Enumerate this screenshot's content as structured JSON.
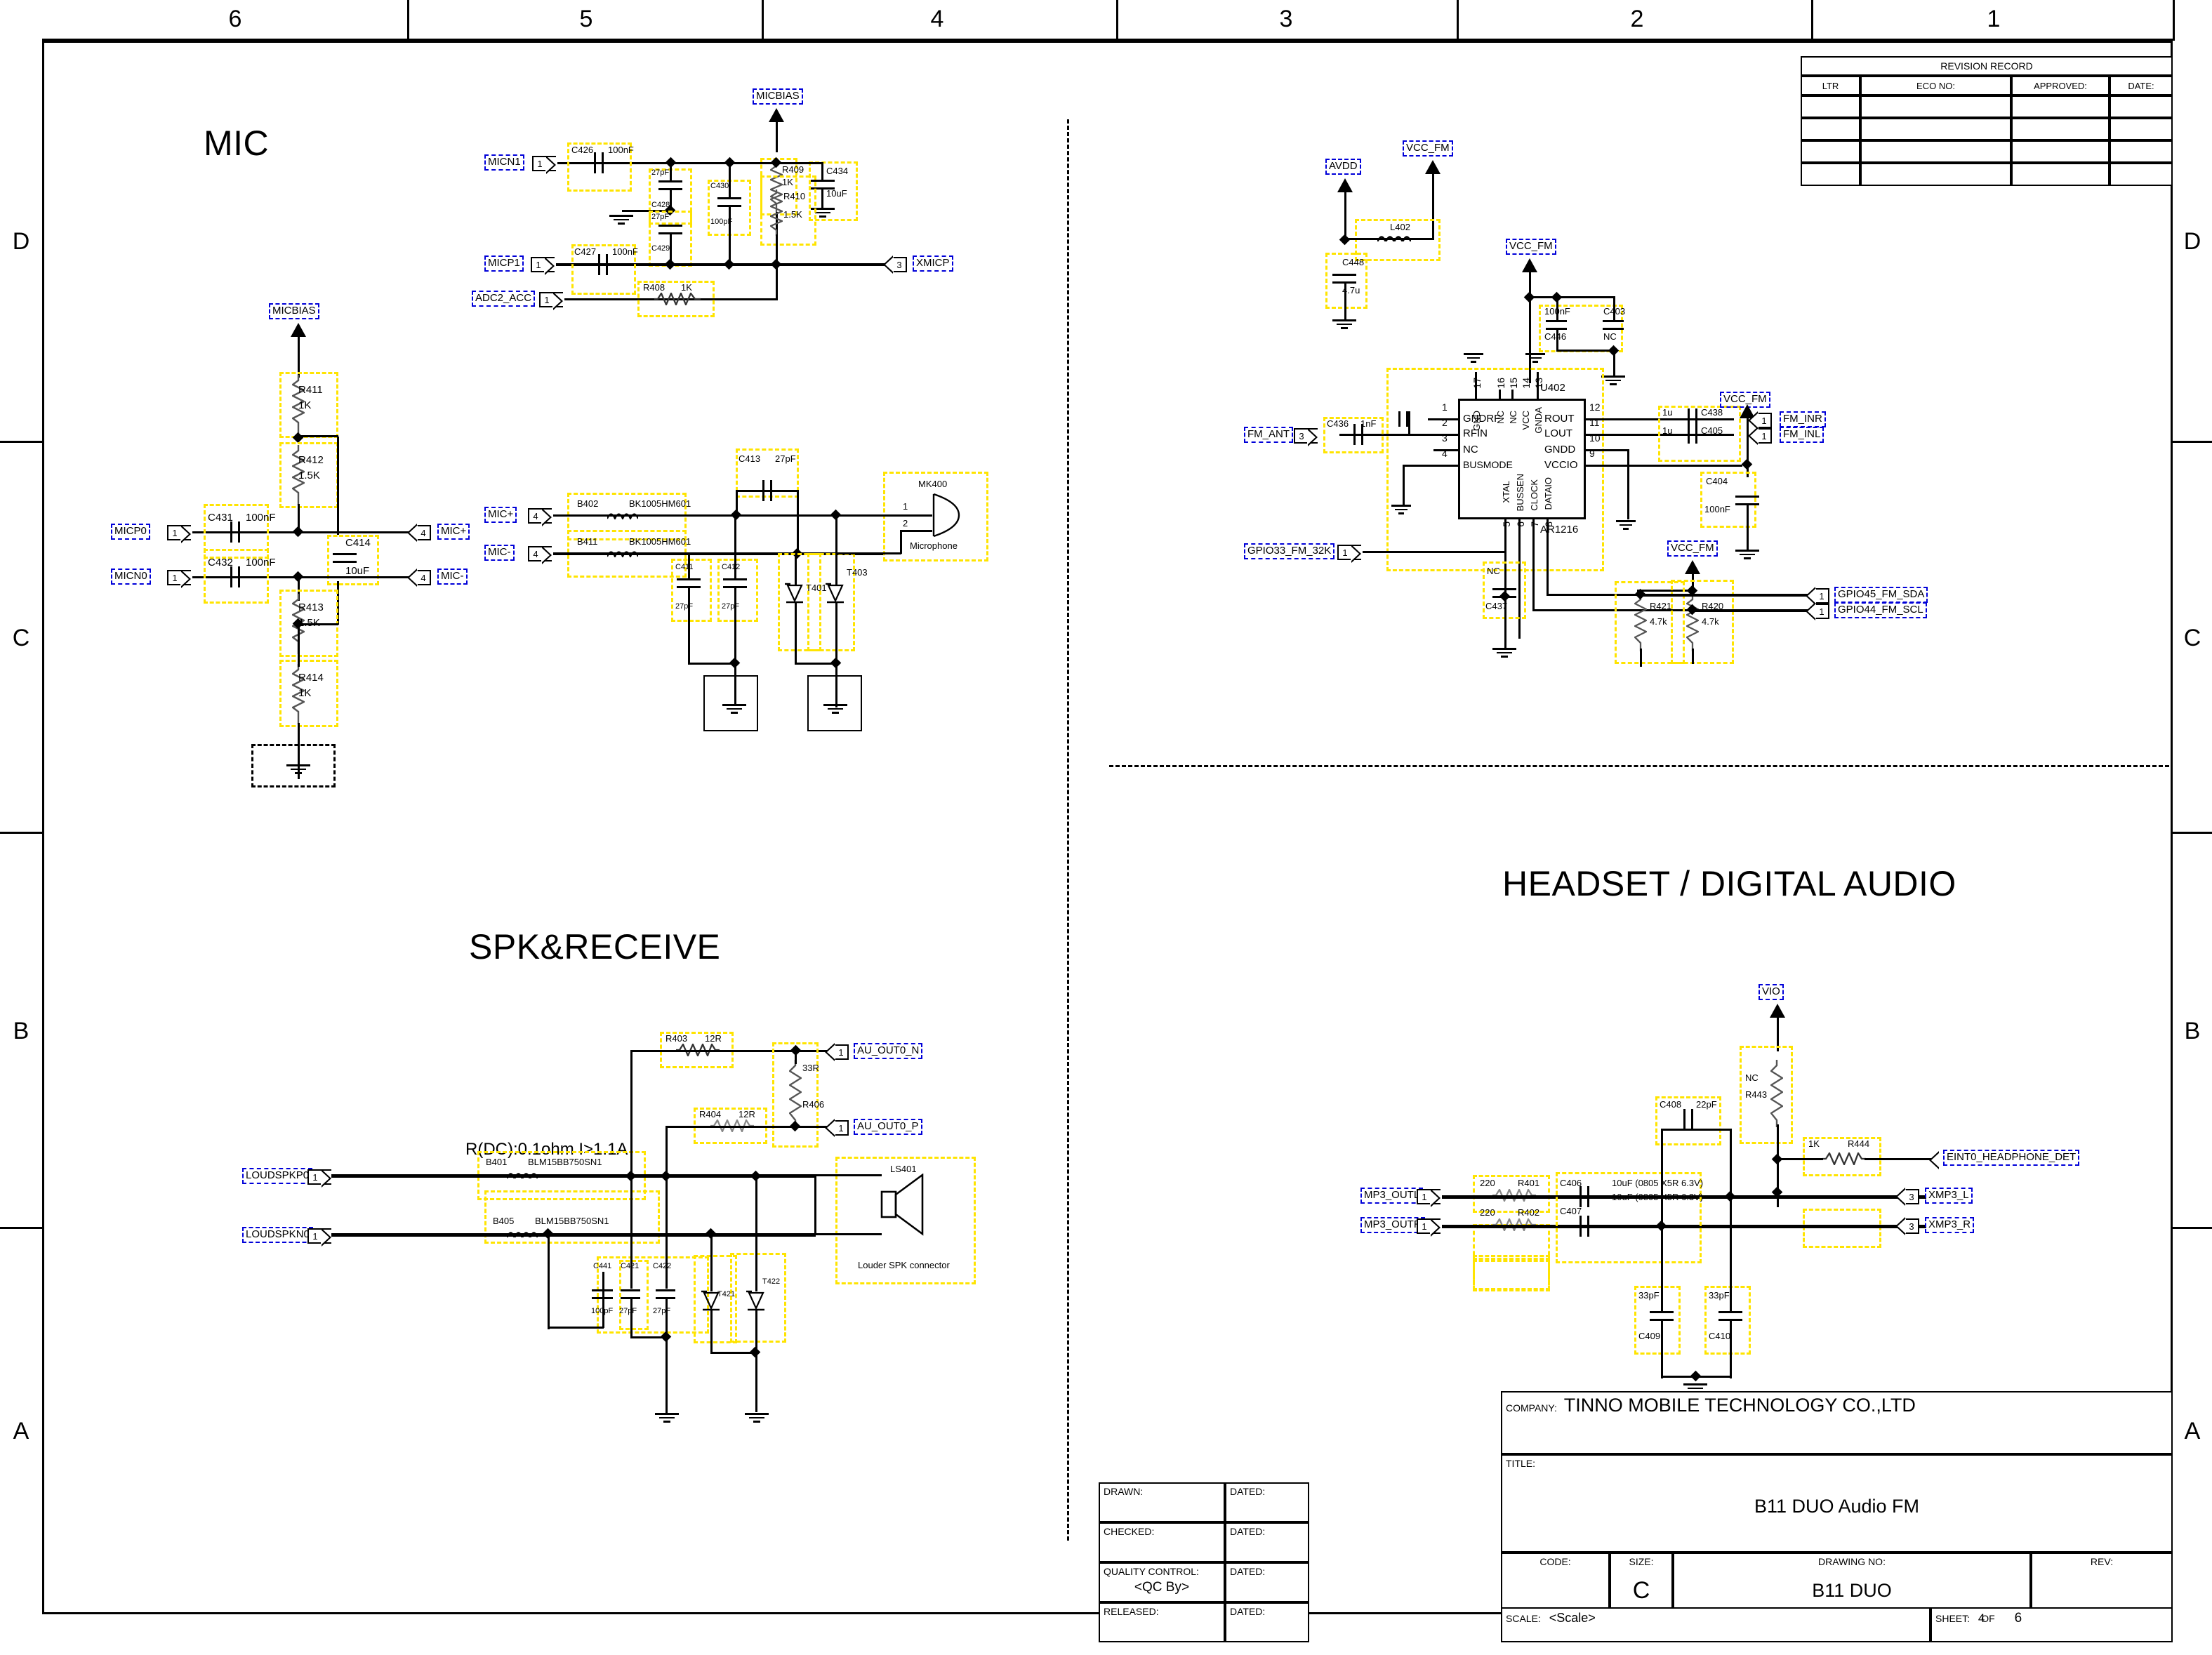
{
  "sheet": {
    "zone_cols": [
      "6",
      "5",
      "4",
      "3",
      "2",
      "1"
    ],
    "zone_rows": [
      "D",
      "C",
      "B",
      "A"
    ]
  },
  "revision_record": {
    "title": "REVISION RECORD",
    "headers": [
      "LTR",
      "ECO NO:",
      "APPROVED:",
      "DATE:"
    ],
    "rows": [
      [
        "",
        "",
        "",
        ""
      ],
      [
        "",
        "",
        "",
        ""
      ],
      [
        "",
        "",
        "",
        ""
      ],
      [
        "",
        "",
        "",
        ""
      ]
    ]
  },
  "headings": {
    "mic": "MIC",
    "spk": "SPK&RECEIVE",
    "headset": "HEADSET / DIGITAL AUDIO"
  },
  "mic_block": {
    "note_micbias_top": "MICBIAS",
    "nets": {
      "micp0": "MICP0",
      "micn0": "MICN0",
      "micbias": "MICBIAS",
      "mic_plus": "MIC+",
      "mic_minus": "MIC-",
      "micn1": "MICN1",
      "micp1": "MICP1",
      "adc2_acc": "ADC2_ACC",
      "xmicp": "XMICP"
    },
    "parts": {
      "r411": {
        "ref": "R411",
        "val": "1K"
      },
      "r412": {
        "ref": "R412",
        "val": "1.5K"
      },
      "r413": {
        "ref": "R413",
        "val": "1.5K"
      },
      "r414": {
        "ref": "R414",
        "val": "1K"
      },
      "c431": {
        "ref": "C431",
        "val": "100nF"
      },
      "c432": {
        "ref": "C432",
        "val": "100nF"
      },
      "c414": {
        "ref": "C414",
        "val": "10uF"
      },
      "r409": {
        "ref": "R409",
        "val": "1K"
      },
      "r410": {
        "ref": "R410",
        "val": "1.5K"
      },
      "r408": {
        "ref": "R408",
        "val": "1K"
      },
      "c426": {
        "ref": "C426",
        "val": "100nF"
      },
      "c427": {
        "ref": "C427",
        "val": "100nF"
      },
      "c428": {
        "ref": "C428",
        "val": "27pF"
      },
      "c429": {
        "ref": "C429",
        "val": "27pF"
      },
      "c430": {
        "ref": "C430",
        "val": "100pF"
      },
      "c434": {
        "ref": "C434",
        "val": "10uF"
      },
      "b402": {
        "ref": "B402",
        "val": "BK1005HM601"
      },
      "b411": {
        "ref": "B411",
        "val": "BK1005HM601"
      },
      "c411": {
        "ref": "C411",
        "val": "27pF"
      },
      "c412": {
        "ref": "C412",
        "val": "27pF"
      },
      "c413": {
        "ref": "C413",
        "val": "27pF"
      },
      "t401": {
        "ref": "T401",
        "val": ""
      },
      "t403": {
        "ref": "T403",
        "val": ""
      },
      "mk400": {
        "ref": "MK400",
        "desc": "Microphone",
        "pins": [
          "1",
          "2"
        ]
      }
    },
    "port_nums": {
      "p1": "1",
      "p3": "3",
      "p4": "4"
    }
  },
  "spk_block": {
    "note": "R(DC):0.1ohm I>1.1A",
    "nets": {
      "loudspkp0": "LOUDSPKP0",
      "loudspkn0": "LOUDSPKN0",
      "au_out0_n": "AU_OUT0_N",
      "au_out0_p": "AU_OUT0_P"
    },
    "parts": {
      "r403": {
        "ref": "R403",
        "val": "12R"
      },
      "r404": {
        "ref": "R404",
        "val": "12R"
      },
      "r406": {
        "ref": "R406",
        "val": "33R"
      },
      "b401": {
        "ref": "B401",
        "val": "BLM15BB750SN1"
      },
      "b405": {
        "ref": "B405",
        "val": "BLM15BB750SN1"
      },
      "c441": {
        "ref": "C441",
        "val": "100pF"
      },
      "c421": {
        "ref": "C421",
        "val": "27pF"
      },
      "c422": {
        "ref": "C422",
        "val": "27pF"
      },
      "t421": {
        "ref": "T421",
        "val": ""
      },
      "t422": {
        "ref": "T422",
        "val": ""
      },
      "ls401": {
        "ref": "LS401",
        "desc": "Louder SPK connector"
      }
    },
    "port_nums": {
      "p1": "1"
    }
  },
  "fm_block": {
    "nets": {
      "avdd": "AVDD",
      "vcc_fm": "VCC_FM",
      "fm_ant": "FM_ANT",
      "fm_inr": "FM_INR",
      "fm_inl": "FM_INL",
      "gpio33": "GPIO33_FM_32K",
      "gpio45": "GPIO45_FM_SDA",
      "gpio44": "GPIO44_FM_SCL"
    },
    "ic": {
      "ref": "U402",
      "part": "AR1216",
      "left_pins": [
        {
          "num": "1",
          "name": "GNDRF"
        },
        {
          "num": "2",
          "name": "RFIN"
        },
        {
          "num": "3",
          "name": "NC"
        },
        {
          "num": "4",
          "name": "BUSMODE"
        }
      ],
      "right_pins": [
        {
          "num": "12",
          "name": "ROUT"
        },
        {
          "num": "11",
          "name": "LOUT"
        },
        {
          "num": "10",
          "name": "GNDD"
        },
        {
          "num": "9",
          "name": "VCCIO"
        }
      ],
      "top_pins": [
        {
          "num": "17",
          "name": "GND"
        },
        {
          "num": "16",
          "name": "NC"
        },
        {
          "num": "15",
          "name": "NC"
        },
        {
          "num": "14",
          "name": "VCC"
        },
        {
          "num": "13",
          "name": "GNDA"
        }
      ],
      "bottom_pins": [
        {
          "num": "5",
          "name": "XTAL"
        },
        {
          "num": "6",
          "name": "BUSSEN"
        },
        {
          "num": "7",
          "name": "CLOCK"
        },
        {
          "num": "8",
          "name": "DATAIO"
        }
      ]
    },
    "parts": {
      "l402": {
        "ref": "L402",
        "val": ""
      },
      "c448": {
        "ref": "C448",
        "val": "4.7u"
      },
      "c446": {
        "ref": "C446",
        "val": "100nF"
      },
      "c403": {
        "ref": "C403",
        "val": "NC"
      },
      "c436": {
        "ref": "C436",
        "val": "1nF"
      },
      "c437": {
        "ref": "C437",
        "val": "NC"
      },
      "c438": {
        "ref": "C438",
        "val": "1u"
      },
      "c405": {
        "ref": "C405",
        "val": "1u"
      },
      "c404": {
        "ref": "C404",
        "val": "100nF"
      },
      "r421": {
        "ref": "R421",
        "val": "4.7k"
      },
      "r420": {
        "ref": "R420",
        "val": "4.7k"
      }
    },
    "port_nums": {
      "p1": "1",
      "p3": "3"
    }
  },
  "headset_block": {
    "nets": {
      "vio": "VIO",
      "mp3_outl": "MP3_OUTL",
      "mp3_outr": "MP3_OUTR",
      "eint0": "EINT0_HEADPHONE_DET",
      "xmp3_l": "XMP3_L",
      "xmp3_r": "XMP3_R"
    },
    "parts": {
      "r401": {
        "ref": "R401",
        "val": "220"
      },
      "r402": {
        "ref": "R402",
        "val": "220"
      },
      "r443": {
        "ref": "R443",
        "val": "NC"
      },
      "r444": {
        "ref": "R444",
        "val": "1K"
      },
      "c406": {
        "ref": "C406",
        "val": "10uF (0805 X5R 6.3V)"
      },
      "c407": {
        "ref": "C407",
        "val": "10uF (0805 X5R 6.3V)"
      },
      "c408": {
        "ref": "C408",
        "val": "22pF"
      },
      "c409": {
        "ref": "C409",
        "val": "33pF"
      },
      "c410": {
        "ref": "C410",
        "val": "33pF"
      }
    },
    "port_nums": {
      "p1": "1",
      "p3": "3"
    }
  },
  "title_block": {
    "company_label": "COMPANY:",
    "company": "TINNO MOBILE TECHNOLOGY CO.,LTD",
    "title_label": "TITLE:",
    "title": "B11 DUO   Audio FM",
    "code_label": "CODE:",
    "code": "",
    "size_label": "SIZE:",
    "size": "C",
    "drawing_no_label": "DRAWING NO:",
    "drawing_no": "B11  DUO",
    "rev_label": "REV:",
    "rev": "",
    "scale_label": "SCALE:",
    "scale": "<Scale>",
    "sheet_label": "SHEET:",
    "sheet_of": "OF",
    "sheet_num": "4",
    "sheet_total": "6",
    "drawn_label": "DRAWN:",
    "drawn_dated": "DATED:",
    "checked_label": "CHECKED:",
    "checked_dated": "DATED:",
    "qc_label": "QUALITY CONTROL:",
    "qc_value": "<QC By>",
    "qc_dated": "DATED:",
    "released_label": "RELEASED:",
    "released_dated": "DATED:"
  },
  "colors": {
    "highlight": "#ffe400",
    "netlabel": "#0000d8",
    "wire": "#000000"
  }
}
